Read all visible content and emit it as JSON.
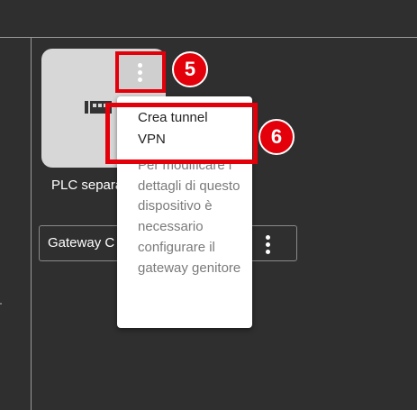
{
  "device": {
    "label": "PLC separato",
    "icon": "device-icon"
  },
  "gateway": {
    "label": "Gateway C"
  },
  "context_menu": {
    "item": "Crea tunnel VPN",
    "note": "Per modificare i dettagli di questo dispositivo è necessario configurare il gateway genitore"
  },
  "annotations": {
    "step_a": "5",
    "step_b": "6",
    "color": "#e3000b"
  }
}
